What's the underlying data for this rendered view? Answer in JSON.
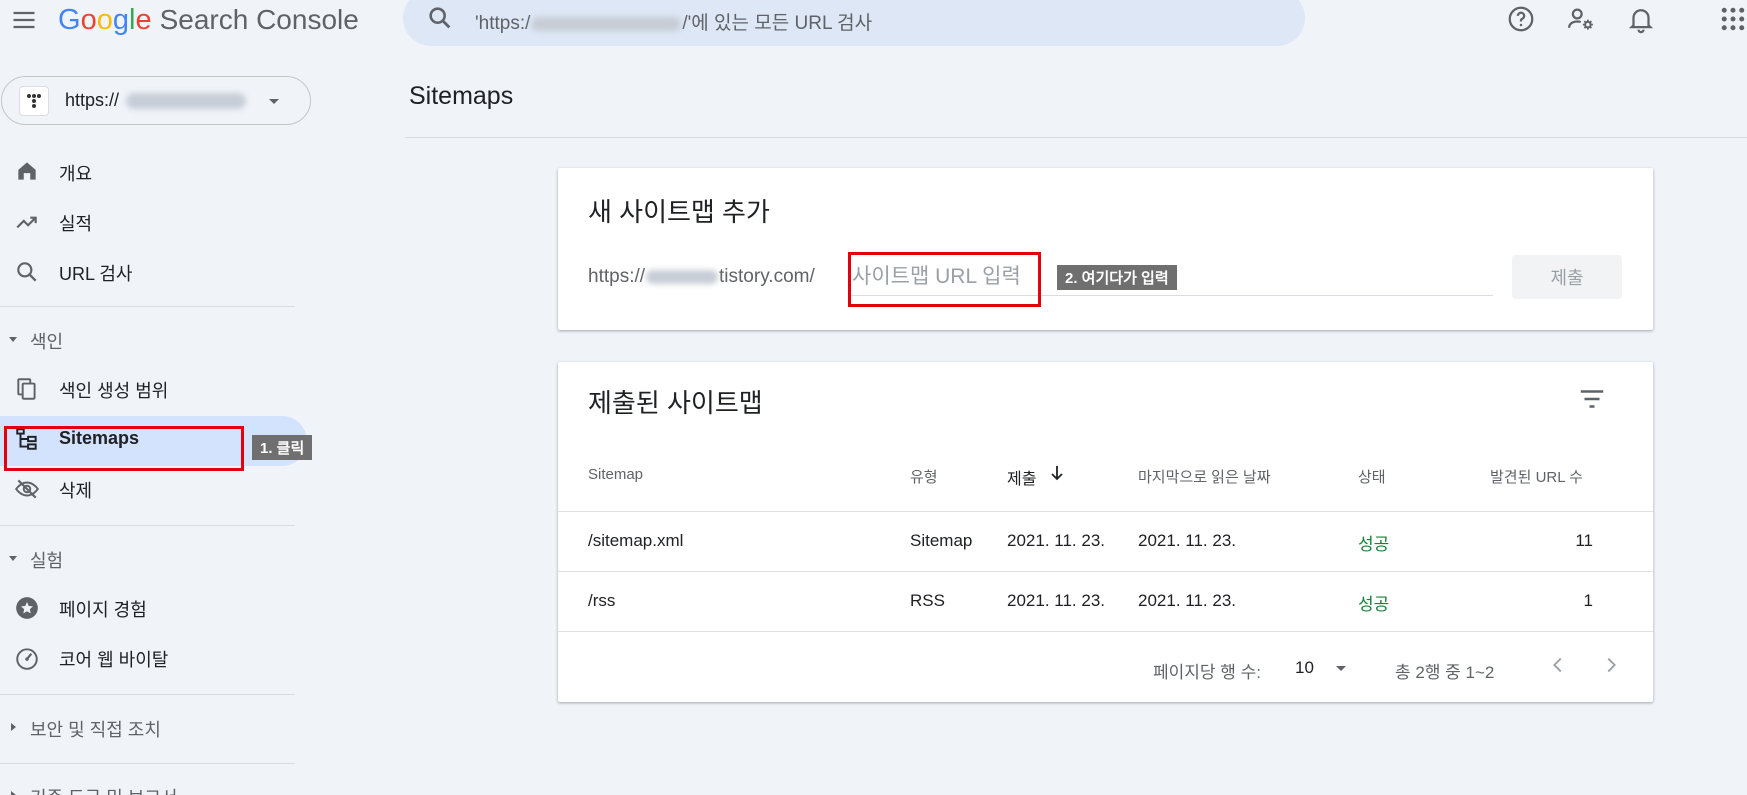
{
  "header": {
    "logo_letters": [
      "G",
      "o",
      "o",
      "g",
      "l",
      "e"
    ],
    "product": "Search Console",
    "search_prefix": "'https:/",
    "search_suffix": "/'에 있는 모든 URL 검사"
  },
  "property": {
    "label": "https://"
  },
  "sidebar": {
    "items": [
      {
        "label": "개요",
        "icon": "home-icon"
      },
      {
        "label": "실적",
        "icon": "trending-up-icon"
      },
      {
        "label": "URL 검사",
        "icon": "search-icon"
      }
    ],
    "index_section": "색인",
    "index_items": [
      {
        "label": "색인 생성 범위",
        "icon": "copy-icon"
      },
      {
        "label": "Sitemaps",
        "icon": "sitemap-icon"
      },
      {
        "label": "삭제",
        "icon": "eye-off-icon"
      }
    ],
    "experience_section": "실험",
    "experience_items": [
      {
        "label": "페이지 경험",
        "icon": "star-circle-icon"
      },
      {
        "label": "코어 웹 바이탈",
        "icon": "gauge-icon"
      }
    ],
    "security_section": "보안 및 직접 조치",
    "legacy_section": "기존 도구 및 보고서"
  },
  "annotations": {
    "click": "1. 클릭",
    "input": "2. 여기다가 입력"
  },
  "main": {
    "title": "Sitemaps",
    "add_card": {
      "title": "새 사이트맵 추가",
      "prefix_start": "https://",
      "prefix_end": "tistory.com/",
      "placeholder": "사이트맵 URL 입력",
      "submit": "제출"
    },
    "submitted_card": {
      "title": "제출된 사이트맵",
      "columns": [
        "Sitemap",
        "유형",
        "제출",
        "마지막으로 읽은 날짜",
        "상태",
        "발견된 URL 수"
      ],
      "rows": [
        {
          "sitemap": "/sitemap.xml",
          "type": "Sitemap",
          "submitted": "2021. 11. 23.",
          "last_read": "2021. 11. 23.",
          "status": "성공",
          "urls": "11"
        },
        {
          "sitemap": "/rss",
          "type": "RSS",
          "submitted": "2021. 11. 23.",
          "last_read": "2021. 11. 23.",
          "status": "성공",
          "urls": "1"
        }
      ],
      "rows_per_page_label": "페이지당 행 수:",
      "rows_per_page": "10",
      "range": "총 2행 중 1~2"
    }
  },
  "colors": {
    "accent": "#1a73e8",
    "success": "#188038",
    "annotation_red": "#e3000f",
    "active_bg": "#d3e3fd"
  }
}
